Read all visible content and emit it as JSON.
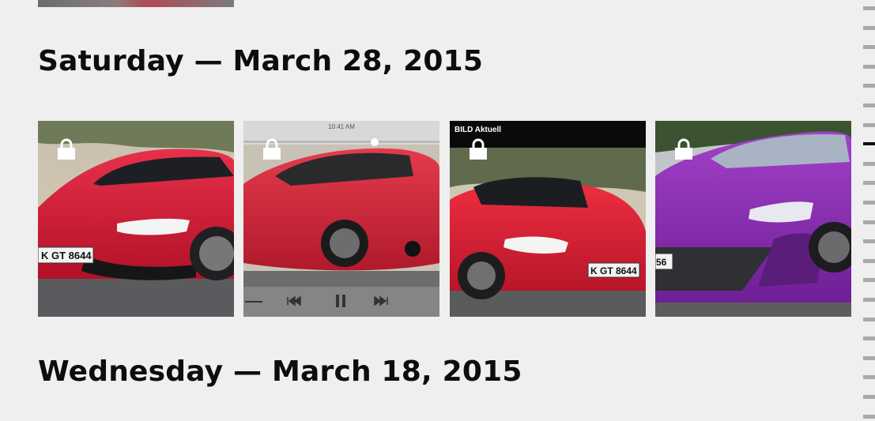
{
  "sections": [
    {
      "date_label": "Saturday — March 28, 2015",
      "photos": [
        {
          "icon": "lock-icon",
          "subject": "red sports car front",
          "plate": "K GT 8644"
        },
        {
          "icon": "lock-icon",
          "subject": "red sports car rear three-quarter video",
          "status_time": "10:41 AM"
        },
        {
          "icon": "lock-icon",
          "subject": "red sports car front",
          "caption": "BILD Aktuell",
          "plate": "K GT 8644"
        },
        {
          "icon": "lock-icon",
          "subject": "purple sports car front",
          "plate": "56"
        }
      ]
    },
    {
      "date_label": "Wednesday — March 18, 2015"
    }
  ],
  "colors": {
    "background": "#efefef",
    "heading": "#0d0d0d",
    "car_red": "#d9203a",
    "car_purple": "#8a2fb0",
    "scrubber_tick": "#a9a9a9",
    "scrubber_active": "#111111"
  }
}
